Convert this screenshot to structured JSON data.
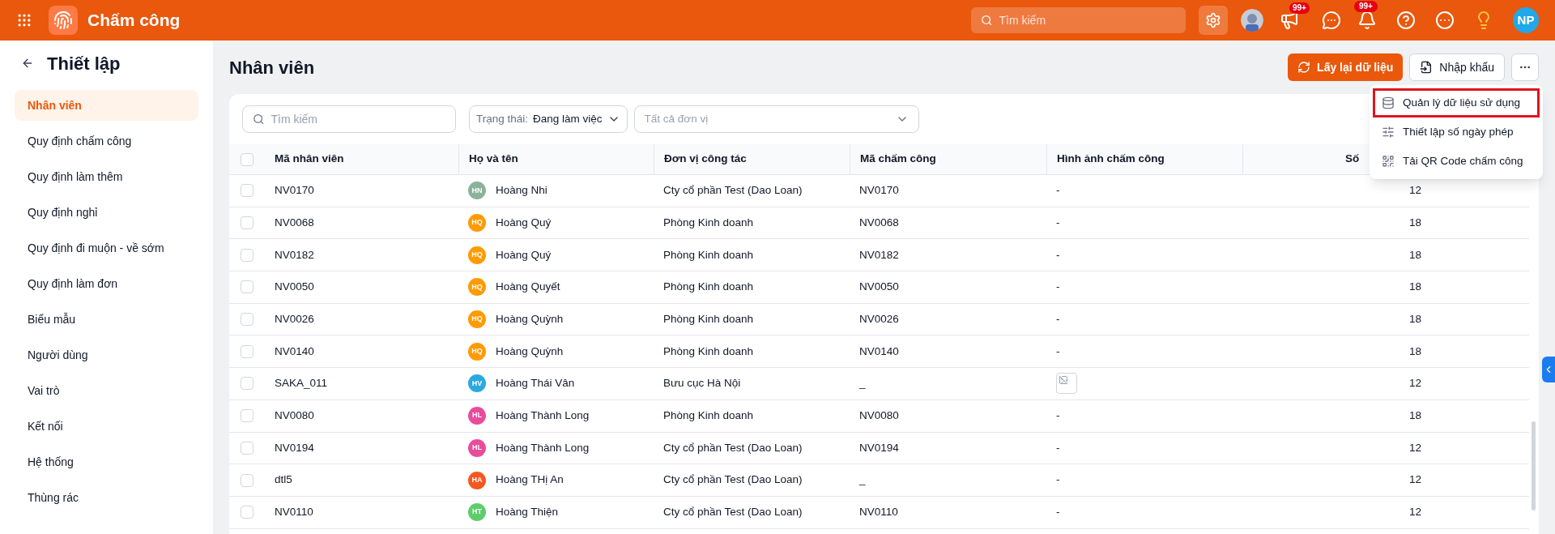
{
  "app": {
    "title": "Chấm công",
    "search": {
      "placeholder": "Tìm kiếm"
    },
    "badges": [
      "99+",
      "99+"
    ],
    "user_initials": "NP"
  },
  "sidebar": {
    "title": "Thiết lập",
    "items": [
      {
        "label": "Nhân viên",
        "selected": true
      },
      {
        "label": "Quy định chấm công",
        "selected": false
      },
      {
        "label": "Quy định làm thêm",
        "selected": false
      },
      {
        "label": "Quy định nghỉ",
        "selected": false
      },
      {
        "label": "Quy định đi muộn - về sớm",
        "selected": false
      },
      {
        "label": "Quy định làm đơn",
        "selected": false
      },
      {
        "label": "Biểu mẫu",
        "selected": false
      },
      {
        "label": "Người dùng",
        "selected": false
      },
      {
        "label": "Vai trò",
        "selected": false
      },
      {
        "label": "Kết nối",
        "selected": false
      },
      {
        "label": "Hệ thống",
        "selected": false
      },
      {
        "label": "Thùng rác",
        "selected": false
      }
    ]
  },
  "page": {
    "title": "Nhân viên",
    "buttons": [
      {
        "label": "Lấy lại dữ liệu",
        "kind": "primary"
      },
      {
        "label": "Nhập khẩu",
        "kind": "secondary"
      }
    ]
  },
  "menu": {
    "items": [
      {
        "label": "Quản lý dữ liệu sử dụng",
        "kind": "database",
        "highlighted": true
      },
      {
        "label": "Thiết lập số ngày phép",
        "kind": "sliders",
        "highlighted": false
      },
      {
        "label": "Tải QR Code chấm công",
        "kind": "qr",
        "highlighted": false
      }
    ]
  },
  "filters": {
    "search_placeholder": "Tìm kiếm",
    "status_label": "Trạng thái:",
    "status_value": "Đang làm việc",
    "unit_placeholder": "Tất cả đơn vị"
  },
  "table": {
    "all_checked": false,
    "columns": [
      "Mã nhân viên",
      "Họ và tên",
      "Đơn vị công tác",
      "Mã chấm công",
      "Hình ảnh chấm công",
      "Số"
    ],
    "rows": [
      {
        "checked": false,
        "code": "NV0170",
        "initials": "HN",
        "color": "#8bb39b",
        "name": "Hoàng Nhi",
        "unit": "Cty cổ phần Test (Dao Loan)",
        "att_code": "NV0170",
        "image": {
          "kind": "text",
          "text": "-"
        },
        "number": "12"
      },
      {
        "checked": false,
        "code": "NV0068",
        "initials": "HQ",
        "color": "#ff9a00",
        "name": "Hoàng Quý",
        "unit": "Phòng Kinh doanh",
        "att_code": "NV0068",
        "image": {
          "kind": "text",
          "text": "-"
        },
        "number": "18"
      },
      {
        "checked": false,
        "code": "NV0182",
        "initials": "HQ",
        "color": "#ff9a00",
        "name": "Hoàng Quý",
        "unit": "Phòng Kinh doanh",
        "att_code": "NV0182",
        "image": {
          "kind": "text",
          "text": "-"
        },
        "number": "18"
      },
      {
        "checked": false,
        "code": "NV0050",
        "initials": "HQ",
        "color": "#ff9a00",
        "name": "Hoàng Quyết",
        "unit": "Phòng Kinh doanh",
        "att_code": "NV0050",
        "image": {
          "kind": "text",
          "text": "-"
        },
        "number": "18"
      },
      {
        "checked": false,
        "code": "NV0026",
        "initials": "HQ",
        "color": "#ff9a00",
        "name": "Hoàng Quỳnh",
        "unit": "Phòng Kinh doanh",
        "att_code": "NV0026",
        "image": {
          "kind": "text",
          "text": "-"
        },
        "number": "18"
      },
      {
        "checked": false,
        "code": "NV0140",
        "initials": "HQ",
        "color": "#ff9a00",
        "name": "Hoàng Quỳnh",
        "unit": "Phòng Kinh doanh",
        "att_code": "NV0140",
        "image": {
          "kind": "text",
          "text": "-"
        },
        "number": "18"
      },
      {
        "checked": false,
        "code": "SAKA_011",
        "initials": "HV",
        "color": "#29a9e1",
        "name": "Hoàng Thái Vân",
        "unit": "Bưu cục Hà Nội",
        "att_code": "_",
        "image": {
          "kind": "broken_image"
        },
        "number": "12"
      },
      {
        "checked": false,
        "code": "NV0080",
        "initials": "HL",
        "color": "#e94c9b",
        "name": "Hoàng Thành Long",
        "unit": "Phòng Kinh doanh",
        "att_code": "NV0080",
        "image": {
          "kind": "text",
          "text": "-"
        },
        "number": "18"
      },
      {
        "checked": false,
        "code": "NV0194",
        "initials": "HL",
        "color": "#e94c9b",
        "name": "Hoàng Thành Long",
        "unit": "Cty cổ phần Test (Dao Loan)",
        "att_code": "NV0194",
        "image": {
          "kind": "text",
          "text": "-"
        },
        "number": "12"
      },
      {
        "checked": false,
        "code": "dtl5",
        "initials": "HA",
        "color": "#f4581f",
        "name": "Hoàng THị An",
        "unit": "Cty cổ phần Test (Dao Loan)",
        "att_code": "_",
        "image": {
          "kind": "text",
          "text": "-"
        },
        "number": "12"
      },
      {
        "checked": false,
        "code": "NV0110",
        "initials": "HT",
        "color": "#5fcc6c",
        "name": "Hoàng Thiện",
        "unit": "Cty cổ phần Test (Dao Loan)",
        "att_code": "NV0110",
        "image": {
          "kind": "text",
          "text": "-"
        },
        "number": "12"
      }
    ]
  }
}
